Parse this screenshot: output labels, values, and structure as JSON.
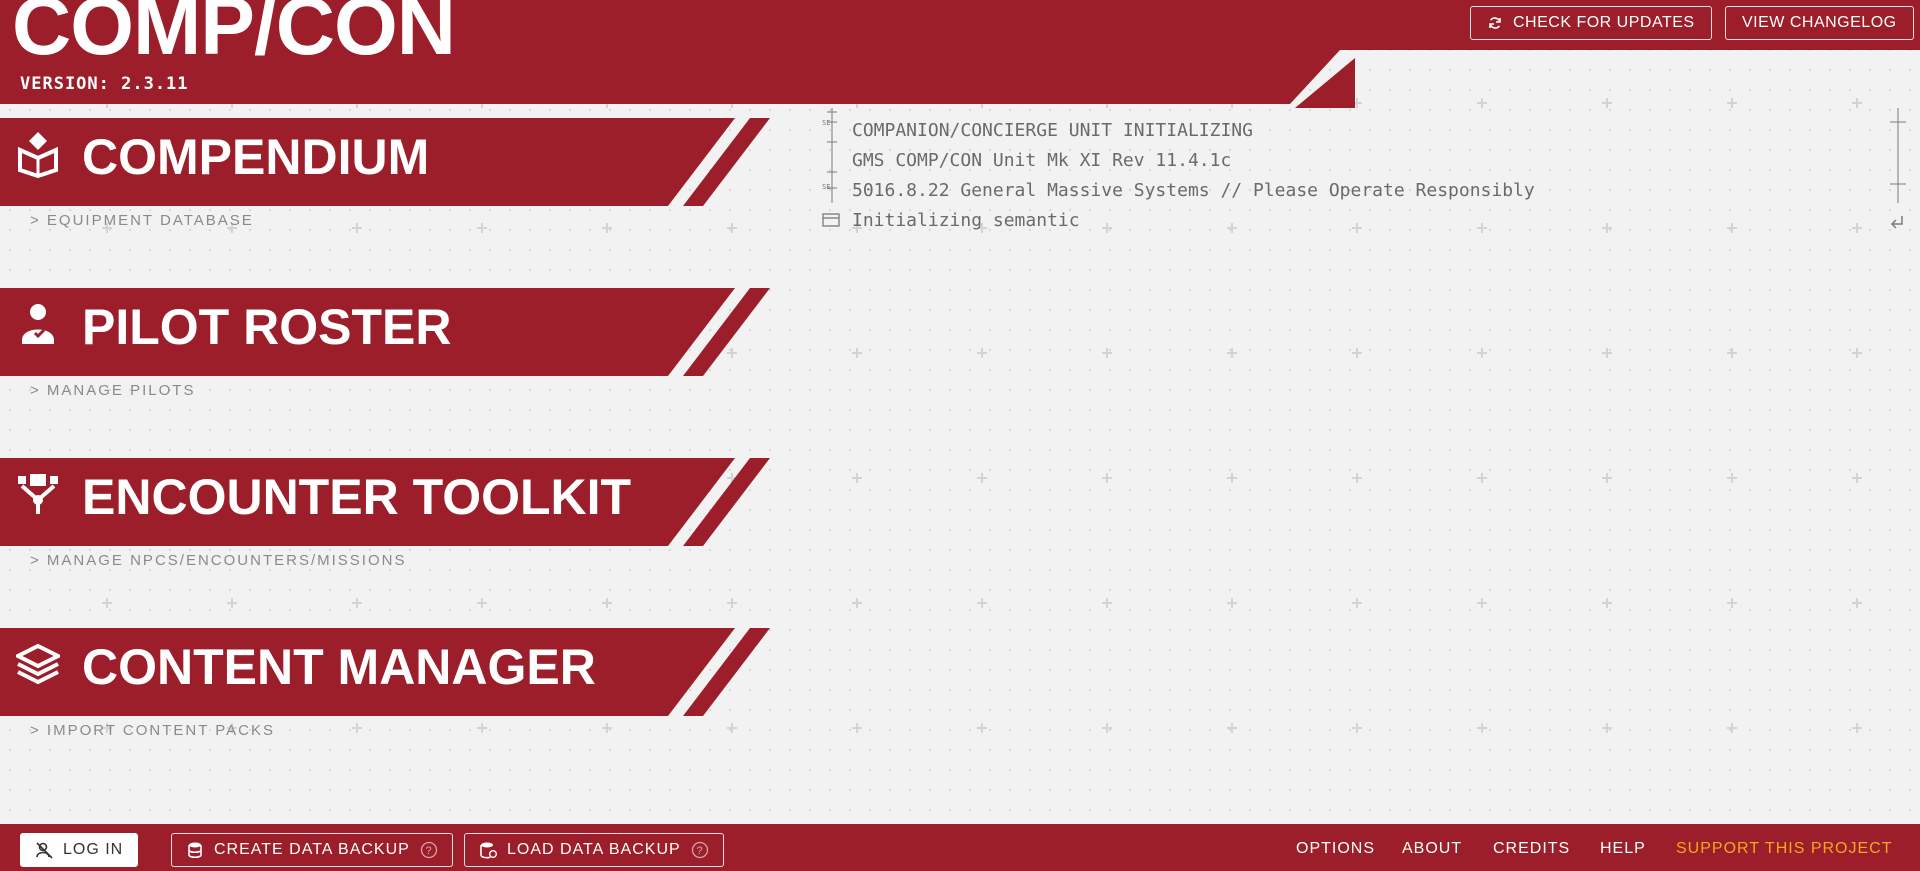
{
  "app": {
    "title": "COMP/CON",
    "version": "VERSION: 2.3.11"
  },
  "header": {
    "check_updates_label": "CHECK FOR UPDATES",
    "changelog_label": "VIEW CHANGELOG"
  },
  "nav": [
    {
      "label": "COMPENDIUM",
      "sublabel": "> EQUIPMENT DATABASE",
      "icon": "compendium-icon"
    },
    {
      "label": "PILOT ROSTER",
      "sublabel": "> MANAGE PILOTS",
      "icon": "pilot-icon"
    },
    {
      "label": "ENCOUNTER TOOLKIT",
      "sublabel": "> MANAGE NPCS/ENCOUNTERS/MISSIONS",
      "icon": "encounter-icon"
    },
    {
      "label": "CONTENT MANAGER",
      "sublabel": "> IMPORT CONTENT PACKS",
      "icon": "content-layers-icon"
    }
  ],
  "terminal": {
    "lines": [
      "COMPANION/CONCIERGE UNIT INITIALIZING",
      "GMS COMP/CON Unit Mk XI Rev 11.4.1c",
      "5016.8.22 General Massive Systems // Please Operate Responsibly",
      "Initializing semantic"
    ]
  },
  "footer": {
    "login_label": "LOG IN",
    "create_backup_label": "CREATE DATA BACKUP",
    "load_backup_label": "LOAD DATA BACKUP",
    "links": {
      "options": "OPTIONS",
      "about": "ABOUT",
      "credits": "CREDITS",
      "help": "HELP",
      "support": "SUPPORT THIS PROJECT"
    }
  },
  "colors": {
    "primary": "#9b1e2a",
    "background": "#f3f2f2",
    "support_link": "#f5a623",
    "terminal_text": "#6a6a6a",
    "subtext": "#8a8a8a"
  }
}
